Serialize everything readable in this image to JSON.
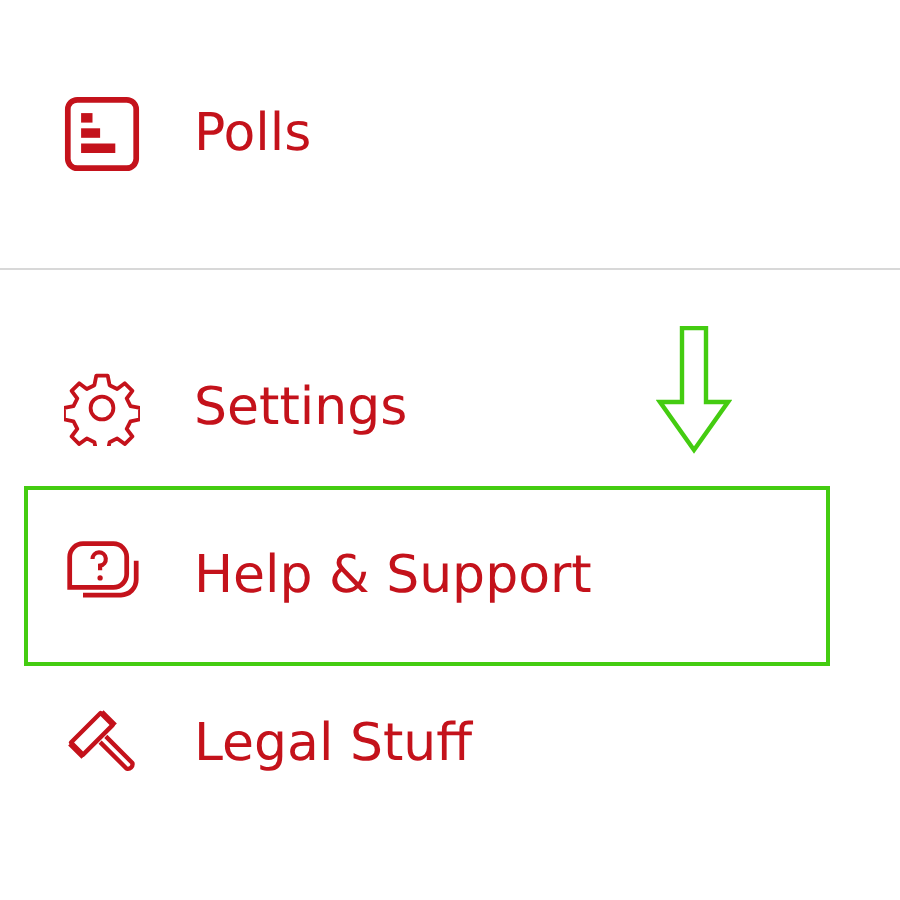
{
  "menu_groups": [
    {
      "items": [
        {
          "kind": "polls",
          "label": "Polls",
          "highlighted": false
        }
      ]
    },
    {
      "items": [
        {
          "kind": "settings",
          "label": "Settings",
          "highlighted": false
        },
        {
          "kind": "help",
          "label": "Help & Support",
          "highlighted": true
        },
        {
          "kind": "legal",
          "label": "Legal Stuff",
          "highlighted": false
        }
      ]
    }
  ]
}
